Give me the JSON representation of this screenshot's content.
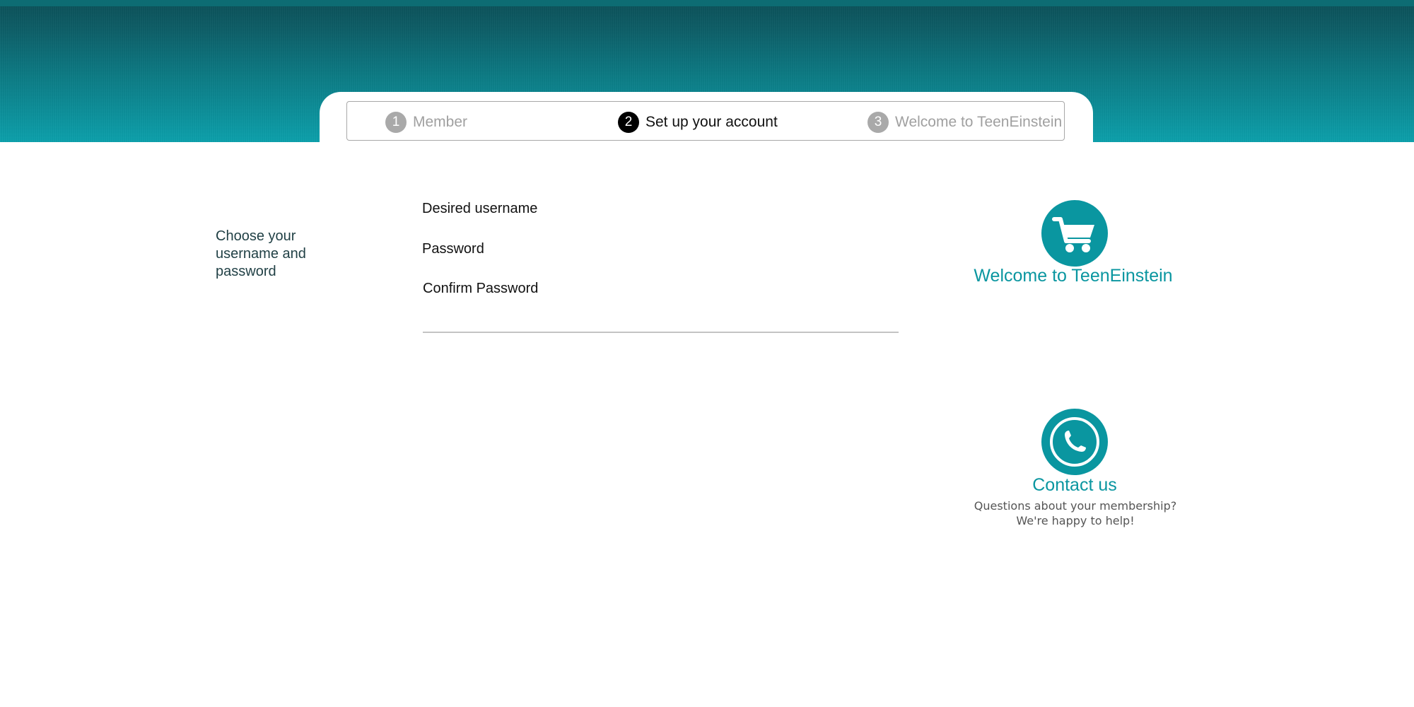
{
  "steps": [
    {
      "number": "1",
      "label": "Member",
      "state": "inactive"
    },
    {
      "number": "2",
      "label": "Set up your account",
      "state": "active"
    },
    {
      "number": "3",
      "label": "Welcome to TeenEinstein",
      "state": "inactive"
    }
  ],
  "form": {
    "intro": "Choose your username and password",
    "username_label": "Desired username",
    "password_label": "Password",
    "confirm_label": "Confirm Password",
    "username_value": "",
    "password_value": "",
    "confirm_value": ""
  },
  "promo": {
    "welcome": {
      "icon": "shopping-cart-icon",
      "title": "Welcome to TeenEinstein"
    },
    "contact": {
      "icon": "phone-icon",
      "title": "Contact us",
      "line1": "Questions about your membership?",
      "line2": "We're happy to help!"
    }
  },
  "colors": {
    "accent": "#0a96a0",
    "header_dark": "#0a4f57",
    "header_light": "#0aa1ac",
    "step_active": "#000000",
    "step_inactive": "#a9a9a9"
  }
}
